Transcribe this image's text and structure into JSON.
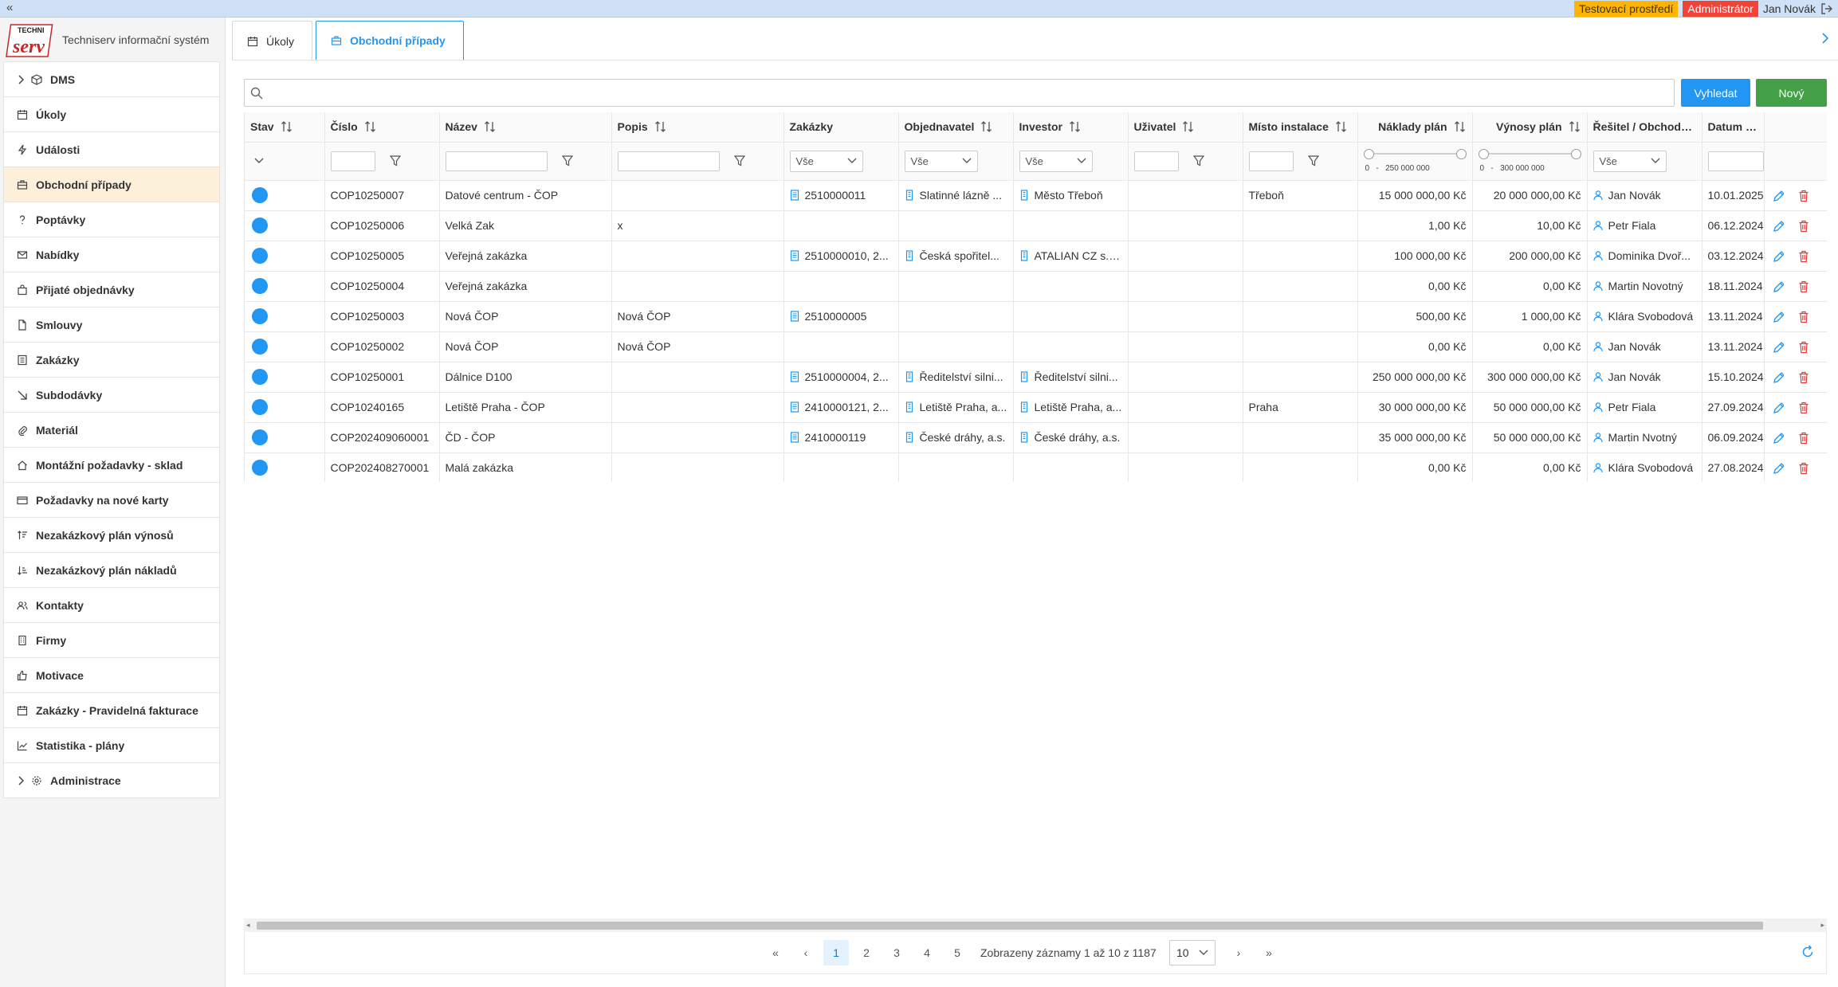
{
  "topbar": {
    "environment_badge": "Testovací prostředí",
    "role_badge": "Administrátor",
    "user_name": "Jan Novák"
  },
  "brand": {
    "logo_text_top": "TECHNI",
    "logo_text_script": "serv",
    "app_title": "Techniserv informační systém"
  },
  "sidebar": {
    "items": [
      {
        "label": "DMS",
        "icon": "box-icon",
        "expandable": true
      },
      {
        "label": "Úkoly",
        "icon": "calendar-icon"
      },
      {
        "label": "Události",
        "icon": "bolt-icon"
      },
      {
        "label": "Obchodní případy",
        "icon": "briefcase-icon",
        "active": true
      },
      {
        "label": "Poptávky",
        "icon": "question-icon"
      },
      {
        "label": "Nabídky",
        "icon": "envelope-icon"
      },
      {
        "label": "Přijaté objednávky",
        "icon": "shopping-bag-icon"
      },
      {
        "label": "Smlouvy",
        "icon": "file-icon"
      },
      {
        "label": "Zakázky",
        "icon": "list-icon"
      },
      {
        "label": "Subdodávky",
        "icon": "arrow-down-right-icon"
      },
      {
        "label": "Materiál",
        "icon": "paperclip-icon"
      },
      {
        "label": "Montážní požadavky - sklad",
        "icon": "home-icon"
      },
      {
        "label": "Požadavky na nové karty",
        "icon": "credit-card-icon"
      },
      {
        "label": "Nezakázkový plán výnosů",
        "icon": "sort-up-icon"
      },
      {
        "label": "Nezakázkový plán nákladů",
        "icon": "sort-down-icon"
      },
      {
        "label": "Kontakty",
        "icon": "users-icon"
      },
      {
        "label": "Firmy",
        "icon": "building-icon"
      },
      {
        "label": "Motivace",
        "icon": "thumbs-up-icon"
      },
      {
        "label": "Zakázky - Pravidelná fakturace",
        "icon": "calendar-icon"
      },
      {
        "label": "Statistika - plány",
        "icon": "chart-line-icon"
      },
      {
        "label": "Administrace",
        "icon": "cog-icon",
        "expandable": true
      }
    ]
  },
  "tabs": [
    {
      "label": "Úkoly",
      "active": false
    },
    {
      "label": "Obchodní případy",
      "active": true
    }
  ],
  "toolbar": {
    "search_placeholder": "",
    "search_value": "",
    "search_button": "Vyhledat",
    "new_button": "Nový"
  },
  "table": {
    "columns": [
      "Stav",
      "Číslo",
      "Název",
      "Popis",
      "Zakázky",
      "Objednavatel",
      "Investor",
      "Uživatel",
      "Místo instalace",
      "Náklady plán",
      "Výnosy plán",
      "Řešitel / Obchodník",
      "Datum vy"
    ],
    "filters": {
      "zakazky_select": "Vše",
      "objednavatel_select": "Vše",
      "investor_select": "Vše",
      "resitel_select": "Vše",
      "naklady_range_min": "0",
      "naklady_range_sep": "-",
      "naklady_range_max": "250 000 000",
      "vynosy_range_min": "0",
      "vynosy_range_sep": "-",
      "vynosy_range_max": "300 000 000"
    },
    "status_color": "#2196f3",
    "rows": [
      {
        "cislo": "COP10250007",
        "nazev": "Datové centrum - ČOP",
        "popis": "",
        "zakazky": "2510000011",
        "objednavatel": "Slatinné lázně ...",
        "investor": "Město Třeboň",
        "uzivatel": "",
        "misto": "Třeboň",
        "naklady": "15 000 000,00 Kč",
        "vynosy": "20 000 000,00 Kč",
        "resitel": "Jan Novák",
        "datum": "10.01.2025"
      },
      {
        "cislo": "COP10250006",
        "nazev": "Velká Zak",
        "popis": "x",
        "zakazky": "",
        "objednavatel": "",
        "investor": "",
        "uzivatel": "",
        "misto": "",
        "naklady": "1,00 Kč",
        "vynosy": "10,00 Kč",
        "resitel": "Petr Fiala",
        "datum": "06.12.2024"
      },
      {
        "cislo": "COP10250005",
        "nazev": "Veřejná zakázka",
        "popis": "",
        "zakazky": "2510000010, 2...",
        "objednavatel": "Česká spořitel...",
        "investor": "ATALIAN CZ s.r....",
        "uzivatel": "",
        "misto": "",
        "naklady": "100 000,00 Kč",
        "vynosy": "200 000,00 Kč",
        "resitel": "Dominika Dvoř...",
        "datum": "03.12.2024"
      },
      {
        "cislo": "COP10250004",
        "nazev": "Veřejná zakázka",
        "popis": "",
        "zakazky": "",
        "objednavatel": "",
        "investor": "",
        "uzivatel": "",
        "misto": "",
        "naklady": "0,00 Kč",
        "vynosy": "0,00 Kč",
        "resitel": "Martin Novotný",
        "datum": "18.11.2024"
      },
      {
        "cislo": "COP10250003",
        "nazev": "Nová ČOP",
        "popis": "Nová ČOP",
        "zakazky": "2510000005",
        "objednavatel": "",
        "investor": "",
        "uzivatel": "",
        "misto": "",
        "naklady": "500,00 Kč",
        "vynosy": "1 000,00 Kč",
        "resitel": "Klára Svobodová",
        "datum": "13.11.2024"
      },
      {
        "cislo": "COP10250002",
        "nazev": "Nová ČOP",
        "popis": "Nová ČOP",
        "zakazky": "",
        "objednavatel": "",
        "investor": "",
        "uzivatel": "",
        "misto": "",
        "naklady": "0,00 Kč",
        "vynosy": "0,00 Kč",
        "resitel": "Jan Novák",
        "datum": "13.11.2024"
      },
      {
        "cislo": "COP10250001",
        "nazev": "Dálnice D100",
        "popis": "",
        "zakazky": "2510000004, 2...",
        "objednavatel": "Ředitelství silni...",
        "investor": "Ředitelství silni...",
        "uzivatel": "",
        "misto": "",
        "naklady": "250 000 000,00 Kč",
        "vynosy": "300 000 000,00 Kč",
        "resitel": "Jan Novák",
        "datum": "15.10.2024"
      },
      {
        "cislo": "COP10240165",
        "nazev": "Letiště Praha - ČOP",
        "popis": "",
        "zakazky": "2410000121, 2...",
        "objednavatel": "Letiště Praha, a...",
        "investor": "Letiště Praha, a...",
        "uzivatel": "",
        "misto": "Praha",
        "naklady": "30 000 000,00 Kč",
        "vynosy": "50 000 000,00 Kč",
        "resitel": "Petr Fiala",
        "datum": "27.09.2024"
      },
      {
        "cislo": "COP202409060001",
        "nazev": "ČD - ČOP",
        "popis": "",
        "zakazky": "2410000119",
        "objednavatel": "České dráhy, a.s.",
        "investor": "České dráhy, a.s.",
        "uzivatel": "",
        "misto": "",
        "naklady": "35 000 000,00 Kč",
        "vynosy": "50 000 000,00 Kč",
        "resitel": "Martin Nvotný",
        "datum": "06.09.2024"
      },
      {
        "cislo": "COP202408270001",
        "nazev": "Malá zakázka",
        "popis": "",
        "zakazky": "",
        "objednavatel": "",
        "investor": "",
        "uzivatel": "",
        "misto": "",
        "naklady": "0,00 Kč",
        "vynosy": "0,00 Kč",
        "resitel": "Klára Svobodová",
        "datum": "27.08.2024"
      }
    ]
  },
  "pagination": {
    "pages": [
      "1",
      "2",
      "3",
      "4",
      "5"
    ],
    "current_page": "1",
    "info": "Zobrazeny záznamy 1 až 10 z 1187",
    "page_size": "10"
  },
  "colors": {
    "primary": "#2196f3",
    "success": "#43a047",
    "danger": "#e53935",
    "env_badge": "#ffb400",
    "role_badge": "#f44336",
    "active_nav": "#fdf0db"
  }
}
